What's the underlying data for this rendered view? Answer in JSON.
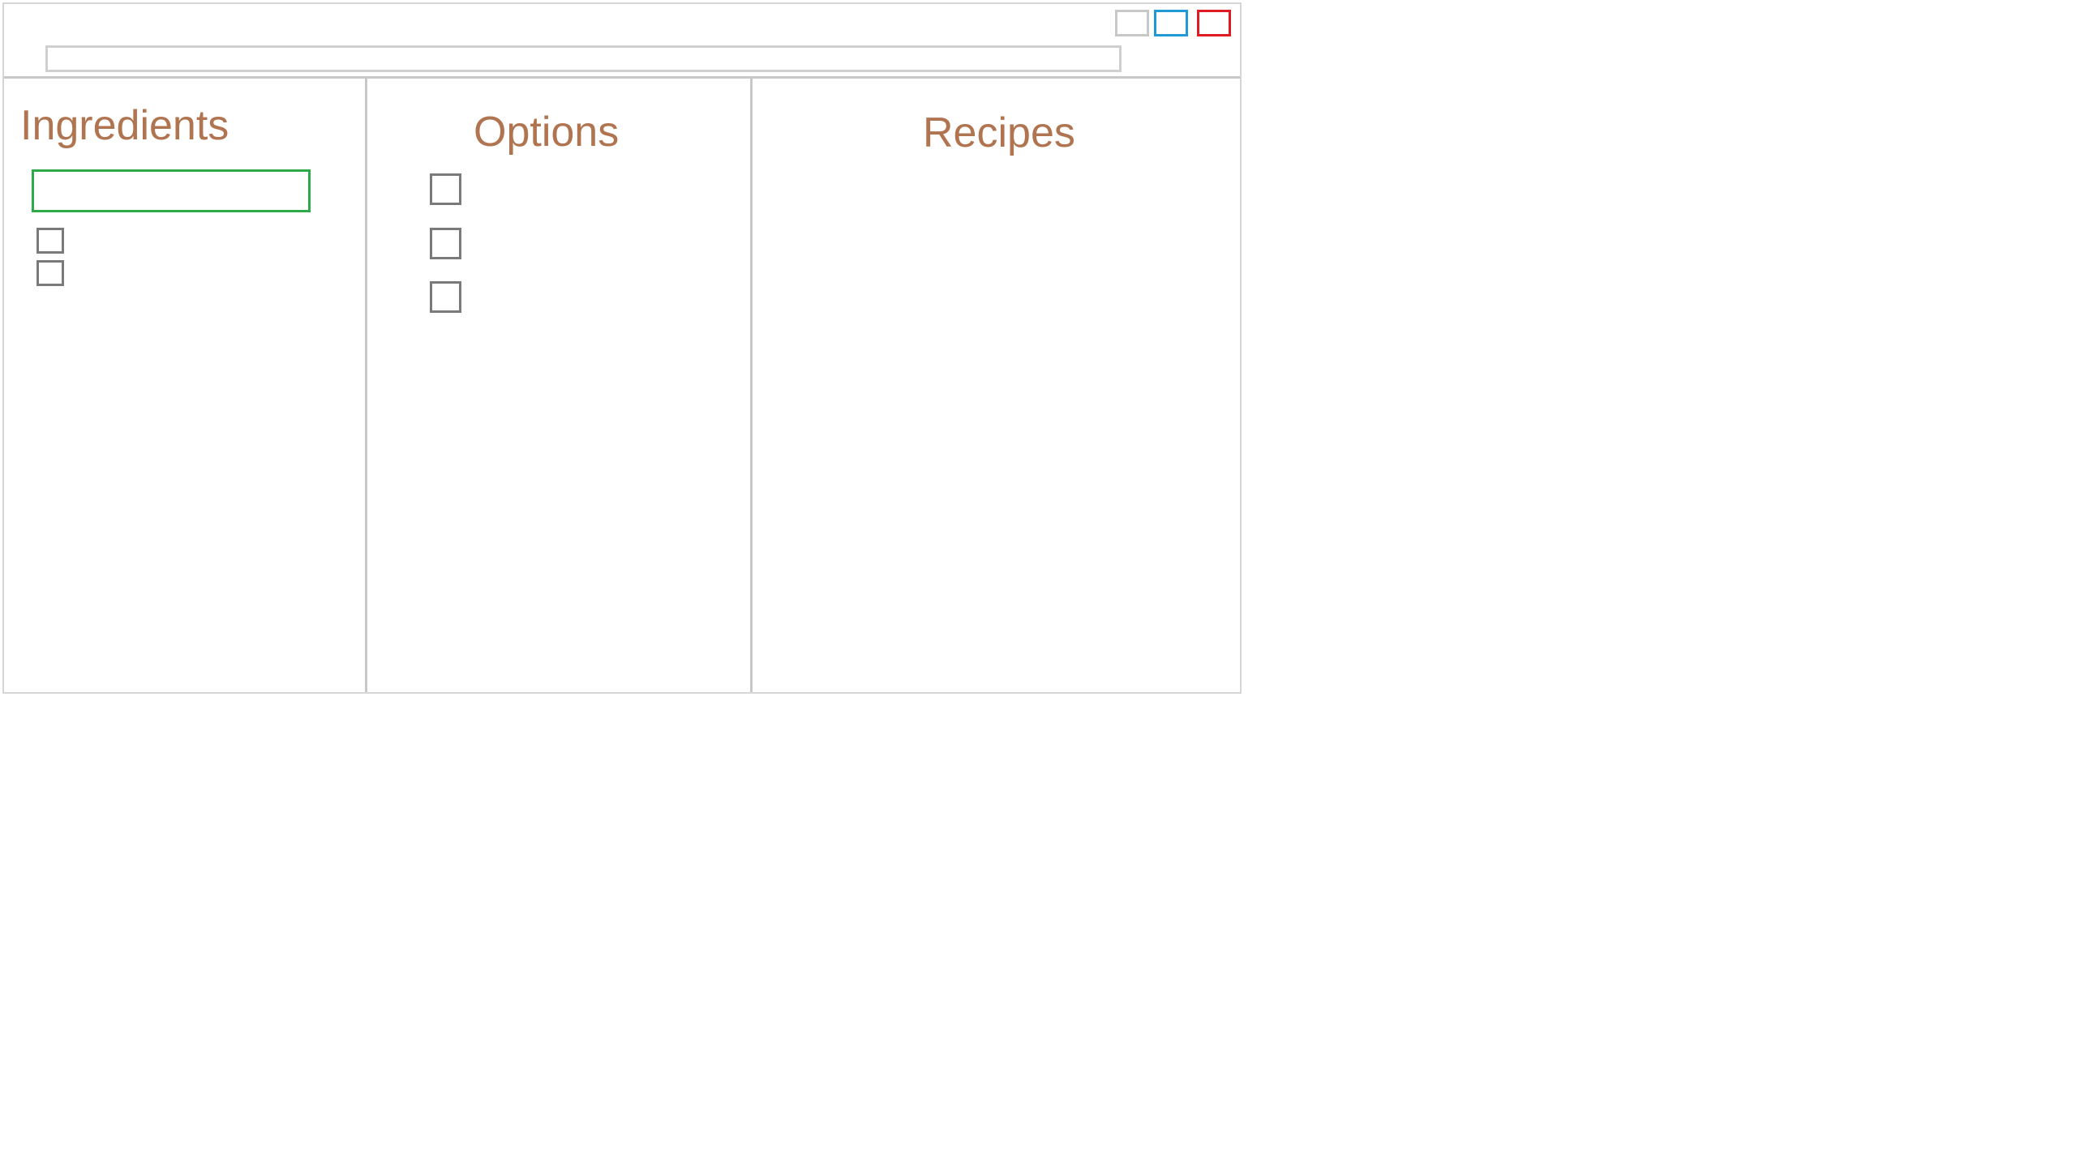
{
  "colors": {
    "panel_title": "#b07550",
    "ingredient_input_border": "#2eaa4a",
    "maximize_button": "#1f9ad6",
    "close_button": "#e01b24"
  },
  "window_controls": {
    "minimize_icon": "minimize-icon",
    "maximize_icon": "maximize-icon",
    "close_icon": "close-icon"
  },
  "address_bar": {
    "value": "",
    "placeholder": ""
  },
  "ingredients": {
    "title": "Ingredients",
    "input_value": "",
    "input_placeholder": "",
    "items": [
      {
        "checked": false
      },
      {
        "checked": false
      }
    ]
  },
  "options": {
    "title": "Options",
    "items": [
      {
        "checked": false
      },
      {
        "checked": false
      },
      {
        "checked": false
      }
    ]
  },
  "recipes": {
    "title": "Recipes",
    "items": []
  }
}
